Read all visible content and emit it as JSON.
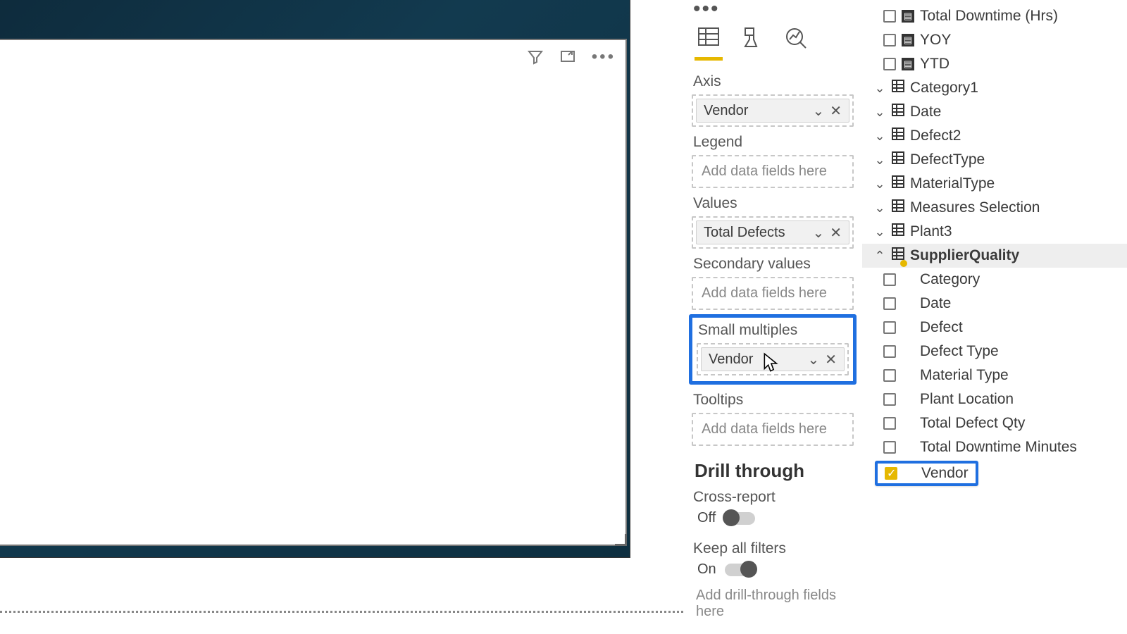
{
  "canvas": {
    "icons": [
      "filter-icon",
      "focus-mode-icon",
      "more-options-icon"
    ]
  },
  "viz": {
    "wells": {
      "axis_label": "Axis",
      "axis_value": "Vendor",
      "legend_label": "Legend",
      "legend_placeholder": "Add data fields here",
      "values_label": "Values",
      "values_value": "Total Defects",
      "secondary_label": "Secondary values",
      "secondary_placeholder": "Add data fields here",
      "smallmult_label": "Small multiples",
      "smallmult_value": "Vendor",
      "tooltips_label": "Tooltips",
      "tooltips_placeholder": "Add data fields here"
    },
    "drill": {
      "heading": "Drill through",
      "cross_label": "Cross-report",
      "cross_value": "Off",
      "keep_label": "Keep all filters",
      "keep_value": "On",
      "placeholder": "Add drill-through fields here"
    }
  },
  "fields": {
    "top_measures": [
      "Total Downtime (Hrs)",
      "YOY",
      "YTD"
    ],
    "tables": [
      "Category1",
      "Date",
      "Defect2",
      "DefectType",
      "MaterialType",
      "Measures Selection",
      "Plant3"
    ],
    "expanded_table": "SupplierQuality",
    "expanded_fields": [
      {
        "name": "Category",
        "checked": false
      },
      {
        "name": "Date",
        "checked": false
      },
      {
        "name": "Defect",
        "checked": false
      },
      {
        "name": "Defect Type",
        "checked": false
      },
      {
        "name": "Material Type",
        "checked": false
      },
      {
        "name": "Plant Location",
        "checked": false
      },
      {
        "name": "Total Defect Qty",
        "checked": false
      },
      {
        "name": "Total Downtime Minutes",
        "checked": false
      },
      {
        "name": "Vendor",
        "checked": true
      }
    ]
  },
  "colors": {
    "highlight": "#1f6fe0",
    "accent": "#e6b800"
  }
}
